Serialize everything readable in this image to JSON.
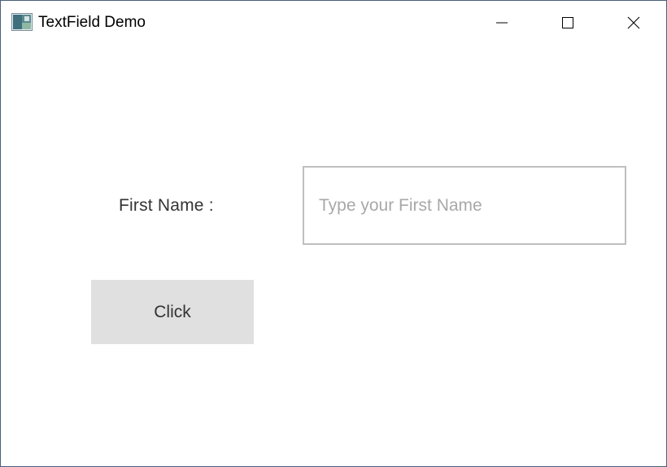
{
  "window": {
    "title": "TextField Demo",
    "controls": {
      "minimize_icon": "minimize-icon",
      "maximize_icon": "maximize-icon",
      "close_icon": "close-icon"
    }
  },
  "form": {
    "first_name_label": "First Name :",
    "first_name_value": "",
    "first_name_placeholder": "Type your First Name",
    "click_button_label": "Click"
  },
  "colors": {
    "button_bg": "#e0e0e0",
    "field_border": "#bfbfbf",
    "placeholder": "#a8a8a8",
    "text": "#333333"
  }
}
